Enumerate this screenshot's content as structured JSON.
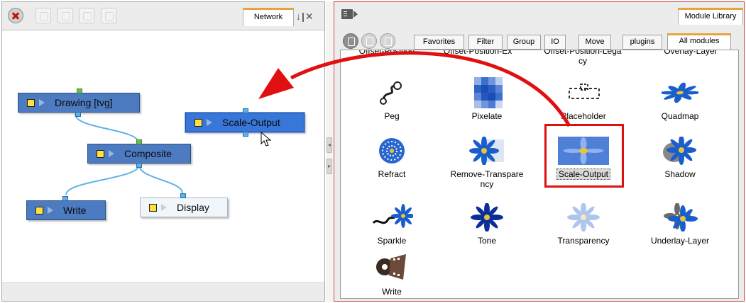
{
  "colors": {
    "accent": "#e8a43a",
    "node_blue": "#4c7bc2",
    "port": "#5fb2e9",
    "highlight": "#e01010",
    "flower": "#1a5ecc"
  },
  "network_panel": {
    "toolbar_icons": [
      "close-icon",
      "check-icon",
      "cancel-icon",
      "display-icon",
      "camera-icon"
    ],
    "tab_label": "Network",
    "nodes": [
      {
        "label": "Drawing [tvg]"
      },
      {
        "label": "Scale-Output"
      },
      {
        "label": "Composite"
      },
      {
        "label": "Write"
      },
      {
        "label": "Display"
      }
    ]
  },
  "library_panel": {
    "tab_label": "Module Library",
    "view_icons": [
      "list-view-icon",
      "detail-view-icon",
      "grid-view-icon"
    ],
    "category_tabs": [
      "Favorites",
      "Filter",
      "Group",
      "IO",
      "Move",
      "plugins",
      "All modules"
    ],
    "active_category": "All modules",
    "cut_row": [
      "Offset-Position",
      "Offset-Position-Ex",
      "Offset-Position-Lega\ncy",
      "Overlay-Layer"
    ],
    "modules": [
      {
        "label": "Peg",
        "icon": "peg-icon"
      },
      {
        "label": "Pixelate",
        "icon": "pixelate-icon"
      },
      {
        "label": "Placeholder",
        "icon": "placeholder-icon"
      },
      {
        "label": "Quadmap",
        "icon": "quadmap-icon"
      },
      {
        "label": "Refract",
        "icon": "refract-icon"
      },
      {
        "label": "Remove-Transpare\nncy",
        "icon": "remove-transparency-icon"
      },
      {
        "label": "Scale-Output",
        "icon": "scale-output-icon",
        "selected": true
      },
      {
        "label": "Shadow",
        "icon": "shadow-icon"
      },
      {
        "label": "Sparkle",
        "icon": "sparkle-icon"
      },
      {
        "label": "Tone",
        "icon": "tone-icon"
      },
      {
        "label": "Transparency",
        "icon": "transparency-icon"
      },
      {
        "label": "Underlay-Layer",
        "icon": "underlay-layer-icon"
      },
      {
        "label": "Write",
        "icon": "write-icon"
      }
    ]
  }
}
